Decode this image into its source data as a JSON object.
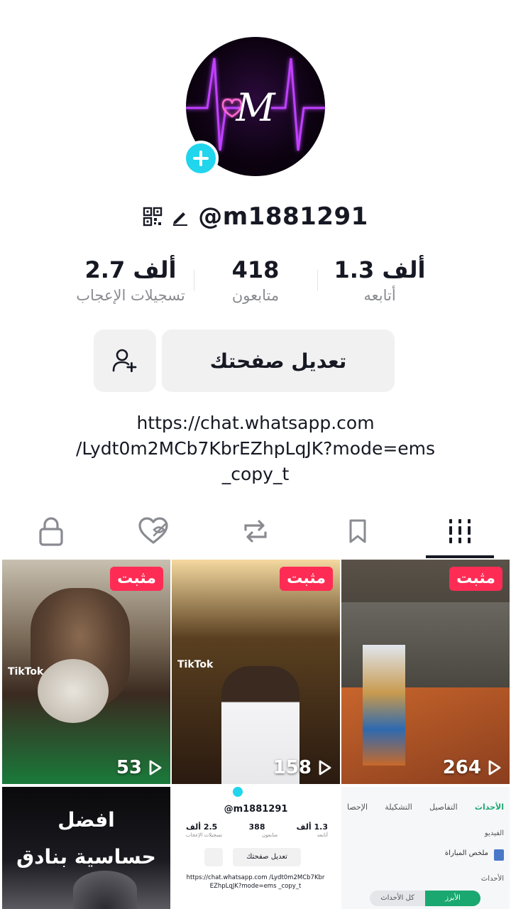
{
  "profile": {
    "username": "@m1881291",
    "avatar_text": "M"
  },
  "stats": {
    "following": {
      "value": "1.3 ألف",
      "label": "أتابعه"
    },
    "followers": {
      "value": "418",
      "label": "متابعون"
    },
    "likes": {
      "value": "2.7 ألف",
      "label": "تسجيلات الإعجاب"
    }
  },
  "actions": {
    "edit_profile": "تعديل صفحتك",
    "add_friend_icon": "person-add-icon"
  },
  "bio": {
    "line1": "https://chat.whatsapp.com",
    "line2": "/Lydt0m2MCb7KbrEZhpLqJK?mode=ems",
    "line3": "_copy_t"
  },
  "tabs": [
    {
      "name": "videos",
      "icon": "grid-icon",
      "active": true
    },
    {
      "name": "saved",
      "icon": "bookmark-icon"
    },
    {
      "name": "reposts",
      "icon": "repost-icon"
    },
    {
      "name": "liked",
      "icon": "hidden-heart-icon"
    },
    {
      "name": "private",
      "icon": "lock-icon"
    }
  ],
  "videos": [
    {
      "pinned": "مثبت",
      "views": "264",
      "colors": [
        "#4a3a2e",
        "#8c5a3a"
      ],
      "watermark": ""
    },
    {
      "pinned": "مثبت",
      "views": "158",
      "colors": [
        "#3a2a1a",
        "#6a4a20"
      ],
      "watermark": "TikTok"
    },
    {
      "pinned": "مثبت",
      "views": "53",
      "colors": [
        "#3a3020",
        "#1e6a2e"
      ],
      "watermark": "TikTok"
    },
    {
      "overlay_text": "",
      "colors": [
        "#f5f6f8",
        "#ffffff"
      ]
    },
    {
      "mini_username": "@m1881291",
      "mini_stats": [
        "1.3 ألف",
        "388",
        "2.5 ألف"
      ],
      "mini_labels": [
        "أتابعه",
        "متابعون",
        "تسجيلات الإعجاب"
      ],
      "mini_button": "تعديل صفحتك",
      "mini_bio": "https://chat.whatsapp.com /Lydt0m2MCb7KbrEZhpLqJK?mode=ems _copy_t",
      "colors": [
        "#ffffff",
        "#ffffff"
      ]
    },
    {
      "overlay_line1": "افضل",
      "overlay_line2": "حساسية بنادق",
      "colors": [
        "#0a0a0c",
        "#2a2a30"
      ]
    }
  ],
  "mini_app": {
    "tabs": [
      "الأحداث",
      "التفاصيل",
      "التشكيلة",
      "الإحصا"
    ],
    "rows": [
      "الفيديو",
      "ملخص المباراة",
      "الأحداث"
    ],
    "bottom_buttons": [
      "الأبرز",
      "كل الأحداث"
    ]
  },
  "colors": {
    "accent": "#fe2c55",
    "add_badge": "#20d5ec",
    "text": "#161823",
    "muted": "#8a8b91"
  }
}
